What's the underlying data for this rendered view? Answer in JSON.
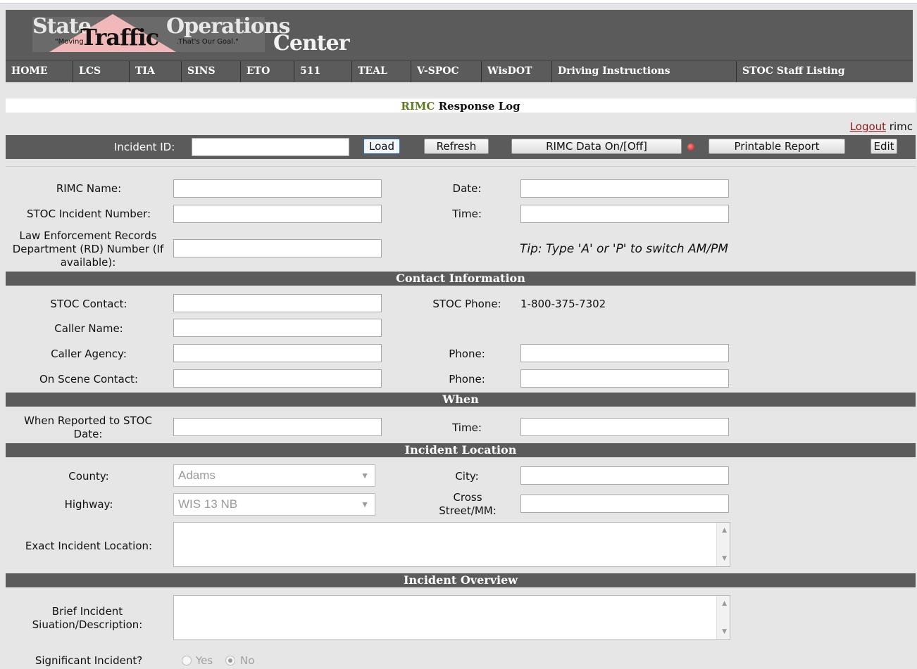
{
  "logo": {
    "line1": "State",
    "line2": "Traffic",
    "line3": "Operations",
    "line4": "Center",
    "tag1": "\"Moving",
    "tag2": ".That's Our Goal.\""
  },
  "nav": [
    {
      "label": "HOME"
    },
    {
      "label": "LCS"
    },
    {
      "label": "TIA"
    },
    {
      "label": "SINS"
    },
    {
      "label": "ETO"
    },
    {
      "label": "511"
    },
    {
      "label": "TEAL"
    },
    {
      "label": "V-SPOC"
    },
    {
      "label": "WisDOT"
    },
    {
      "label": "Driving Instructions"
    },
    {
      "label": "STOC Staff Listing"
    }
  ],
  "page_title": {
    "accent": "RIMC",
    "rest": " Response Log"
  },
  "session": {
    "logout_label": "Logout",
    "user": " rimc"
  },
  "incident_bar": {
    "label": "Incident ID:",
    "load": "Load",
    "refresh": "Refresh",
    "rimc_data": "RIMC Data On/[Off]",
    "printable": "Printable Report",
    "edit": "Edit"
  },
  "form": {
    "rimc_name": "RIMC Name:",
    "date": "Date:",
    "stoc_incident_number": "STOC Incident Number:",
    "time": "Time:",
    "law_rd": "Law Enforcement Records Department (RD) Number (If available):",
    "tip": "Tip: Type 'A' or 'P' to switch AM/PM"
  },
  "sections": {
    "contact": "Contact Information",
    "when": "When",
    "location": "Incident Location",
    "overview": "Incident Overview"
  },
  "contact": {
    "stoc_contact": "STOC Contact:",
    "stoc_phone_label": "STOC Phone:",
    "stoc_phone_value": "1-800-375-7302",
    "caller_name": "Caller Name:",
    "caller_agency": "Caller Agency:",
    "phone": "Phone:",
    "on_scene_contact": "On Scene Contact:"
  },
  "when": {
    "reported_date": "When Reported to STOC Date:",
    "time": "Time:"
  },
  "location": {
    "county": "County:",
    "county_value": "Adams",
    "city": "City:",
    "highway": "Highway:",
    "highway_value": "WIS 13 NB",
    "cross_street": "Cross Street/MM:",
    "exact": "Exact Incident Location:"
  },
  "overview": {
    "brief": "Brief Incident Siuation/Description:",
    "significant": "Significant Incident?",
    "yes": "Yes",
    "no": "No",
    "selected": "No"
  },
  "colors": {
    "header": "#5b5b5b",
    "accent": "#5c7d1e",
    "logout": "#8b1a1a",
    "background": "#e6e6e6"
  }
}
